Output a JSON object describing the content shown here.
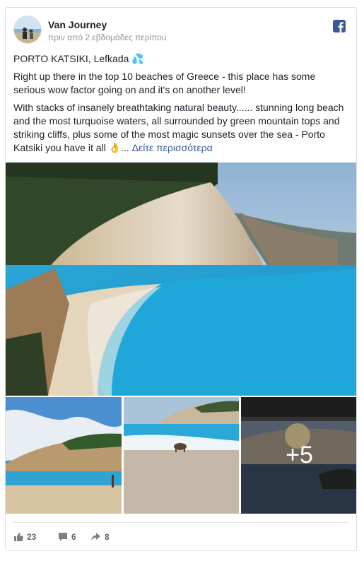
{
  "post": {
    "author": "Van Journey",
    "timestamp": "πριν από 2 εβδομάδες περίπου",
    "title_line": "PORTO KATSIKI, Lefkada 💦",
    "paragraph1": "Right up there in the top 10 beaches of Greece - this place has some serious wow factor going on and it's on another level!",
    "paragraph2": "With stacks of insanely breathtaking natural beauty...... stunning long beach and the most turquoise waters, all surrounded by green mountain tops and striking cliffs, plus some of the most magic sunsets over the sea - Porto Katsiki you have it all 👌...",
    "see_more": "Δείτε περισσότερα",
    "more_photos": "+5"
  },
  "icons": {
    "brand": "facebook-icon",
    "like": "thumbs-up-icon",
    "comment": "comment-icon",
    "share": "share-icon"
  },
  "colors": {
    "facebook_blue": "#3b5998",
    "link_blue": "#365899",
    "muted_text": "#90949c",
    "stat_text": "#606770"
  },
  "stats": {
    "likes": "23",
    "comments": "6",
    "shares": "8"
  }
}
